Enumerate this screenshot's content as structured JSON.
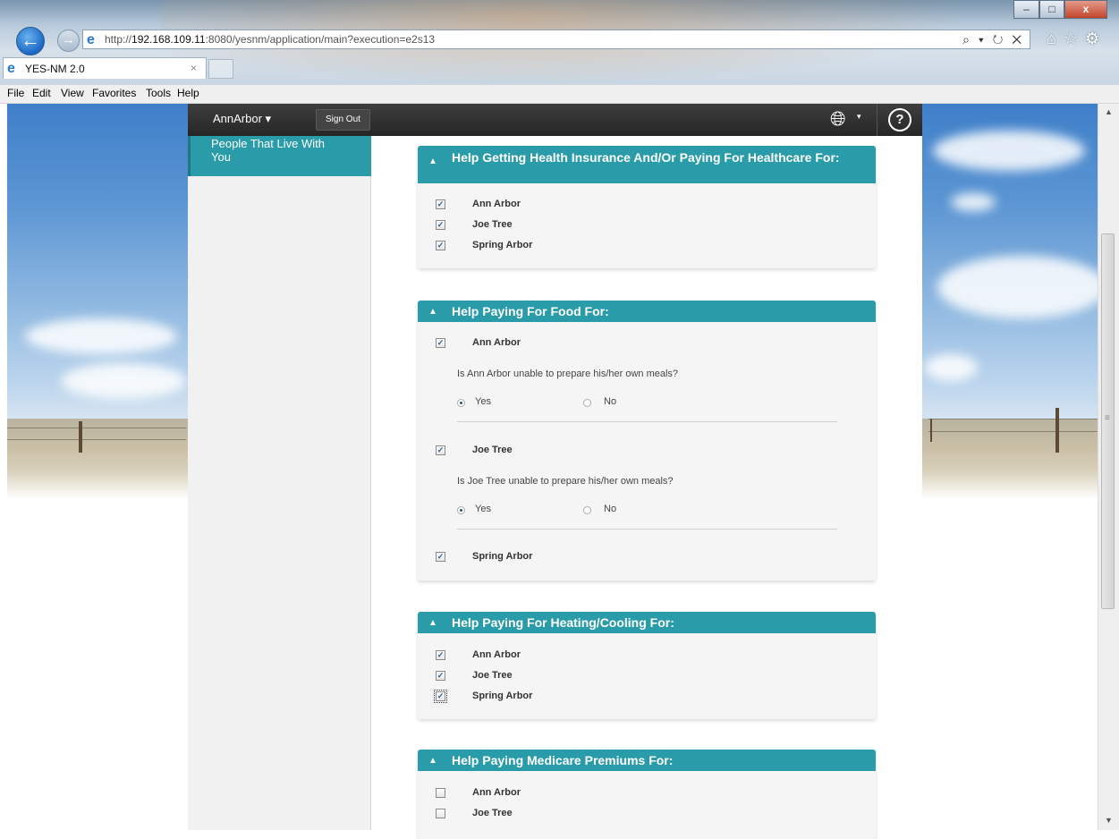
{
  "browser": {
    "url_prefix": "http://",
    "url_host": "192.168.109.11",
    "url_rest": ":8080/yesnm/application/main?execution=e2s13",
    "addr_tools": "⌕ ▾ ↻ ✕",
    "tab_title": "YES-NM 2.0",
    "tab_close": "×",
    "window_buttons": {
      "minimize": "–",
      "maximize": "□",
      "close": "x"
    }
  },
  "menu": {
    "file": "File",
    "edit": "Edit",
    "view": "View",
    "favorites": "Favorites",
    "tools": "Tools",
    "help": "Help"
  },
  "app": {
    "user_menu": "AnnArbor ▾",
    "sign_out": "Sign Out",
    "globe_caret": "▾",
    "help_icon": "?"
  },
  "sidebar": {
    "active_item": "People That Live With You"
  },
  "sections": {
    "health": {
      "title": "Help Getting Health Insurance And/Or Paying For Healthcare For:",
      "people": [
        "Ann Arbor",
        "Joe Tree",
        "Spring Arbor"
      ]
    },
    "food": {
      "title": "Help Paying For Food For:",
      "person1": "Ann Arbor",
      "question1": "Is Ann Arbor unable to prepare his/her own meals?",
      "person2": "Joe Tree",
      "question2": "Is Joe Tree unable to prepare his/her own meals?",
      "person3": "Spring Arbor",
      "yes": "Yes",
      "no": "No"
    },
    "heating": {
      "title": "Help Paying For Heating/Cooling For:",
      "people": [
        "Ann Arbor",
        "Joe Tree",
        "Spring Arbor"
      ]
    },
    "medicare": {
      "title": "Help Paying Medicare Premiums For:",
      "people": [
        "Ann Arbor",
        "Joe Tree"
      ]
    }
  },
  "check_mark": "✓",
  "collapse_icon": "▲"
}
